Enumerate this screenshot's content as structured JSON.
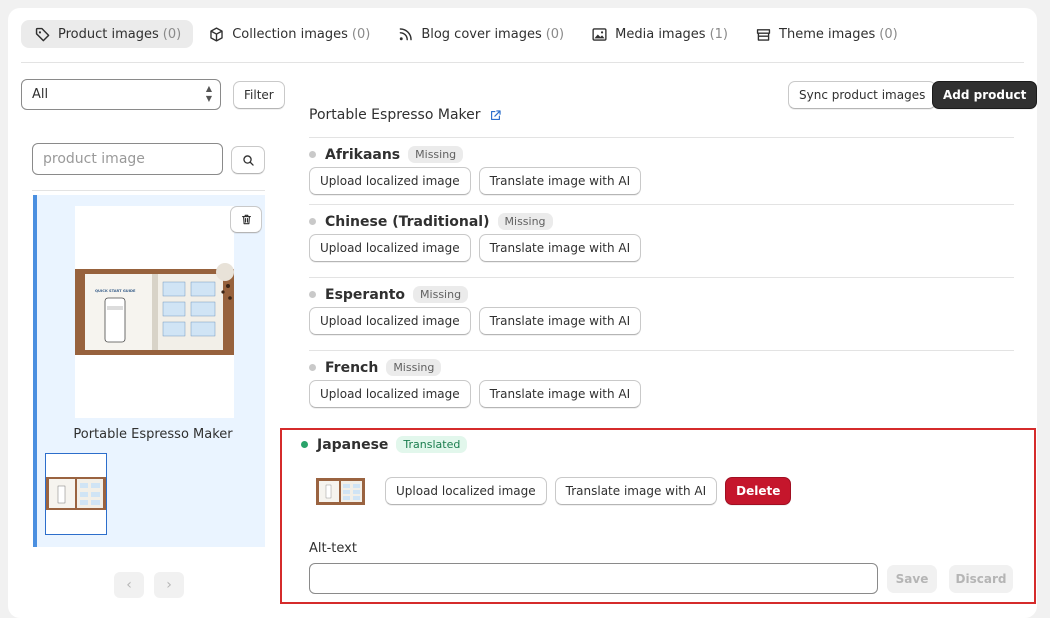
{
  "tabs": [
    {
      "label": "Product images",
      "count": "(0)",
      "icon": "tag-icon",
      "active": true
    },
    {
      "label": "Collection images",
      "count": "(0)",
      "icon": "cube-icon"
    },
    {
      "label": "Blog cover images",
      "count": "(0)",
      "icon": "rss-icon"
    },
    {
      "label": "Media images",
      "count": "(1)",
      "icon": "image-icon"
    },
    {
      "label": "Theme images",
      "count": "(0)",
      "icon": "theme-icon"
    }
  ],
  "filter": {
    "select_value": "All",
    "filter_label": "Filter",
    "search_placeholder": "product image"
  },
  "product": {
    "title": "Portable Espresso Maker",
    "guide_title": "QUICK START GUIDE"
  },
  "toolbar": {
    "sync_label": "Sync product images",
    "add_label": "Add product"
  },
  "languages": [
    {
      "name": "Afrikaans",
      "status": "Missing"
    },
    {
      "name": "Chinese (Traditional)",
      "status": "Missing"
    },
    {
      "name": "Esperanto",
      "status": "Missing"
    },
    {
      "name": "French",
      "status": "Missing"
    }
  ],
  "row_buttons": {
    "upload": "Upload localized image",
    "translate": "Translate image with AI"
  },
  "japanese": {
    "name": "Japanese",
    "status": "Translated",
    "delete_label": "Delete",
    "alt_label": "Alt-text",
    "alt_value": "",
    "save_label": "Save",
    "discard_label": "Discard"
  },
  "colors": {
    "accent": "#303030",
    "selected_border": "#4a8fe0",
    "danger": "#c5162c",
    "success": "#29a36a",
    "highlight": "#d52b2b"
  }
}
